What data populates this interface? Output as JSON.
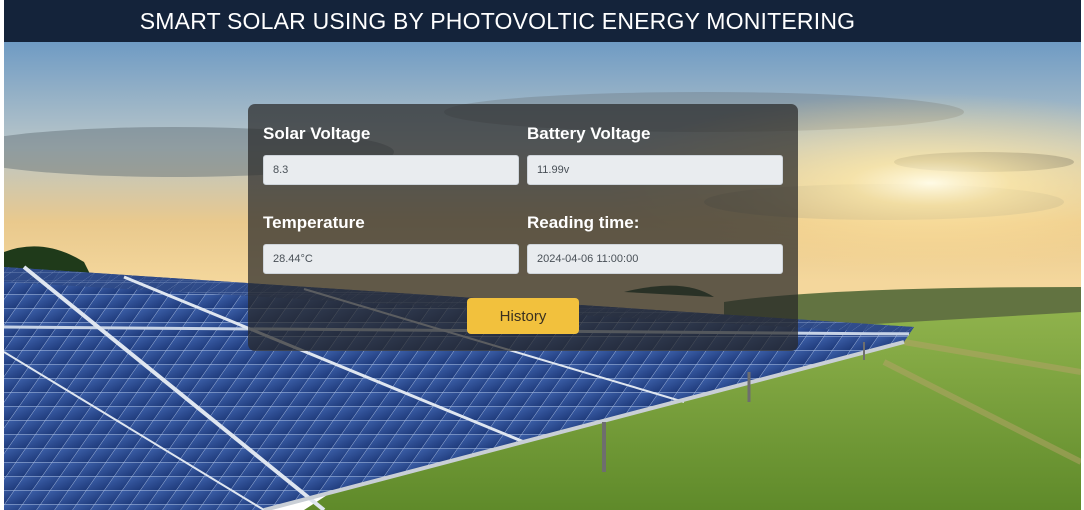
{
  "header": {
    "title": "SMART SOLAR USING BY PHOTOVOLTIC ENERGY MONITERING"
  },
  "panel": {
    "solar_voltage": {
      "label": "Solar Voltage",
      "value": "8.3"
    },
    "battery_voltage": {
      "label": "Battery Voltage",
      "value": "11.99v"
    },
    "temperature": {
      "label": "Temperature",
      "value": "28.44°C"
    },
    "reading_time": {
      "label": "Reading time:",
      "value": "2024-04-06 11:00:00"
    },
    "history_button": "History"
  },
  "colors": {
    "header_bg": "#14233a",
    "panel_bg": "rgba(40,40,40,0.72)",
    "button_bg": "#f2c13d",
    "input_bg": "#e9ecef"
  }
}
